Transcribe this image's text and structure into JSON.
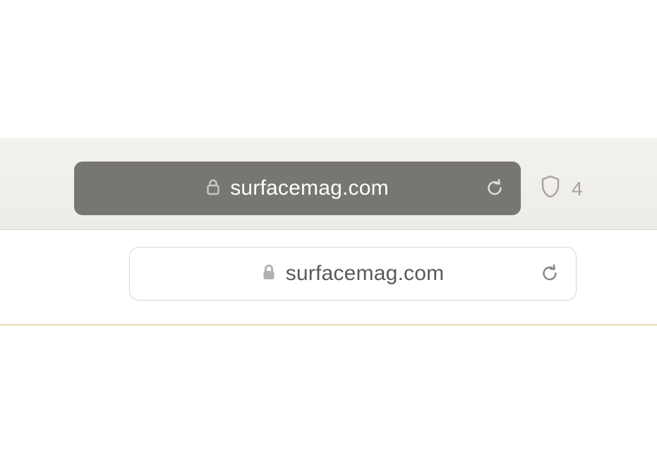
{
  "dark_bar": {
    "url": "surfacemag.com"
  },
  "light_bar": {
    "url": "surfacemag.com"
  },
  "privacy": {
    "tracker_count": "4"
  }
}
